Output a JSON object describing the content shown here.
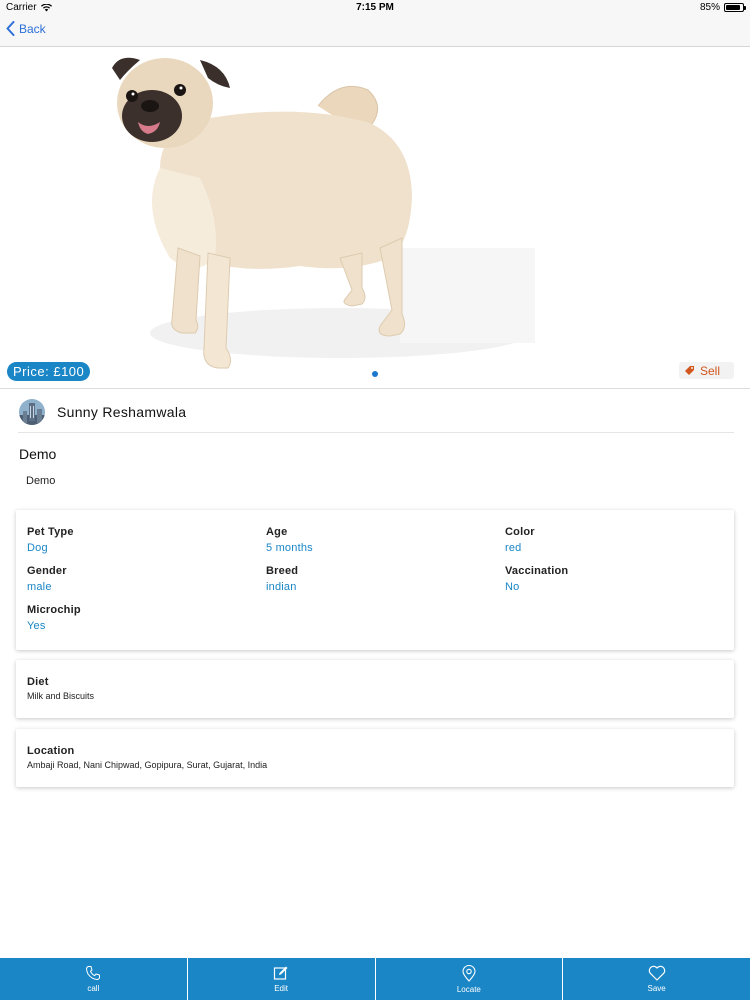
{
  "status_bar": {
    "carrier": "Carrier",
    "time": "7:15 PM",
    "battery": "85%",
    "battery_level": 0.85
  },
  "nav": {
    "back_label": "Back"
  },
  "hero": {
    "price": "Price: £100",
    "sell_label": "Sell",
    "page_count": 1,
    "current_page": 1
  },
  "owner": {
    "name": "Sunny Reshamwala"
  },
  "listing": {
    "title": "Demo",
    "description": "Demo"
  },
  "details": [
    {
      "label": "Pet Type",
      "value": "Dog"
    },
    {
      "label": "Age",
      "value": "5 months"
    },
    {
      "label": "Color",
      "value": "red"
    },
    {
      "label": "Gender",
      "value": "male"
    },
    {
      "label": "Breed",
      "value": "indian"
    },
    {
      "label": "Vaccination",
      "value": "No"
    },
    {
      "label": "Microchip",
      "value": "Yes"
    }
  ],
  "diet": {
    "label": "Diet",
    "value": "Milk and Biscuits"
  },
  "location": {
    "label": "Location",
    "value": "Ambaji Road, Nani Chipwad, Gopipura, Surat, Gujarat, India"
  },
  "tab_bar": {
    "items": [
      {
        "label": "call",
        "icon": "phone-icon"
      },
      {
        "label": "Edit",
        "icon": "edit-icon"
      },
      {
        "label": "Locate",
        "icon": "location-pin-icon"
      },
      {
        "label": "Save",
        "icon": "heart-icon"
      }
    ]
  },
  "colors": {
    "accent": "#1a86c6",
    "link": "#2d6fd8",
    "sell": "#d2561d"
  }
}
